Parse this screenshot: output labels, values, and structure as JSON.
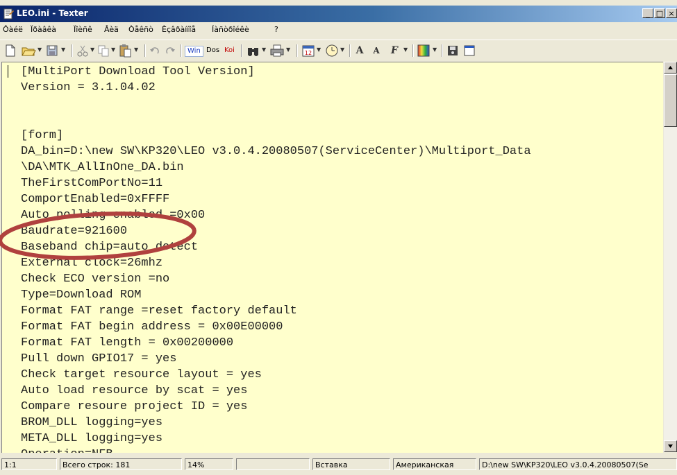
{
  "window": {
    "title": "LEO.ini - Texter",
    "controls": {
      "minimize": "_",
      "maximize": "□",
      "close": "×"
    }
  },
  "menu": [
    "Ôàéë",
    "Ïðàâêà",
    "Ïîèñê",
    "Âèä",
    "Òåêñò",
    "Èçâðàííîå",
    "Íàñòðîéêè",
    "?"
  ],
  "toolbar": {
    "encodings": [
      "Win",
      "Dos",
      "Koi"
    ],
    "encoding_colors": {
      "Win": "#1E3FC0",
      "Dos": "#000000",
      "Koi": "#C00000"
    },
    "font_buttons": [
      "A",
      "A",
      "F"
    ]
  },
  "editor": {
    "background": "#FFFFCC",
    "lines": [
      "[MultiPort Download Tool Version]",
      "Version = 3.1.04.02",
      "",
      "",
      "[form]",
      "DA_bin=D:\\new SW\\KP320\\LEO v3.0.4.20080507(ServiceCenter)\\Multiport_Data",
      "\\DA\\MTK_AllInOne_DA.bin",
      "TheFirstComPortNo=11",
      "ComportEnabled=0xFFFF",
      "Auto polling enabled =0x00",
      "Baudrate=921600",
      "Baseband chip=auto detect",
      "External clock=26mhz",
      "Check ECO version =no",
      "Type=Download ROM",
      "Format FAT range =reset factory default",
      "Format FAT begin address = 0x00E00000",
      "Format FAT length = 0x00200000",
      "Pull down GPIO17 = yes",
      "Check target resource layout = yes",
      "Auto load resource by scat = yes",
      "Compare resoure project ID = yes",
      "BROM_DLL logging=yes",
      "META_DLL logging=yes",
      "Operation=NFB"
    ],
    "highlight_color": "#B0413E"
  },
  "status": {
    "position": "1:1",
    "total_lines": "Всего строк: 181",
    "percent": "14%",
    "mode": "Вставка",
    "keyboard_layout": "Американская",
    "file_path": "D:\\new SW\\KP320\\LEO v3.0.4.20080507(Se"
  }
}
